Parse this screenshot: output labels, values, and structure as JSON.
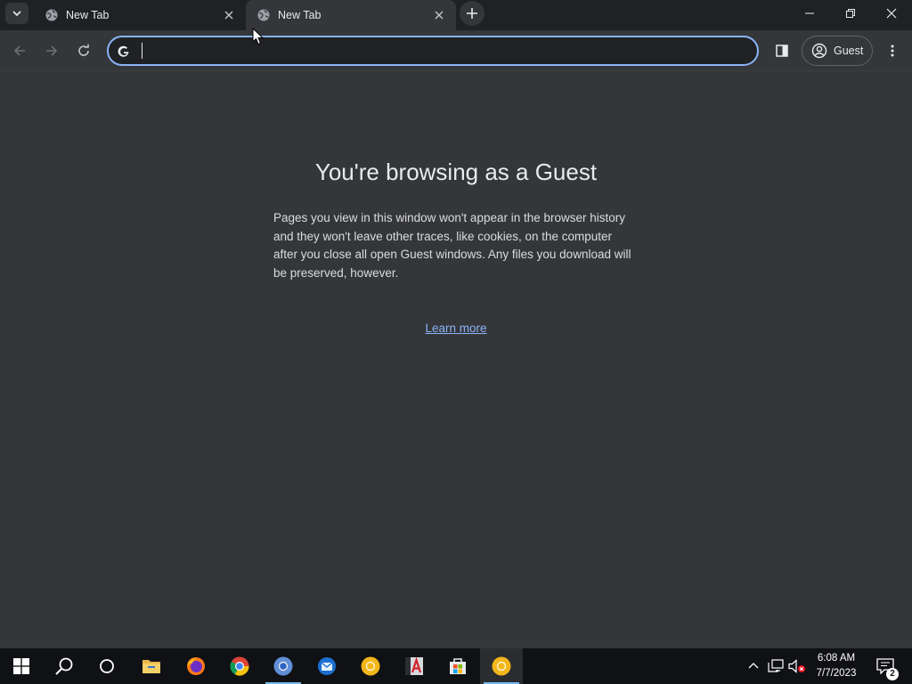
{
  "tabs": [
    {
      "title": "New Tab",
      "active": false
    },
    {
      "title": "New Tab",
      "active": true
    }
  ],
  "toolbar": {
    "omnibox_value": "",
    "profile_label": "Guest"
  },
  "content": {
    "heading": "You're browsing as a Guest",
    "description": "Pages you view in this window won't appear in the browser history and they won't leave other traces, like cookies, on the computer after you close all open Guest windows. Any files you download will be preserved, however.",
    "learn_more": "Learn more"
  },
  "taskbar": {
    "apps": [
      "start-icon",
      "search-icon",
      "cortana-icon",
      "file-explorer-icon",
      "firefox-icon",
      "chrome-icon",
      "chrome-icon",
      "thunderbird-icon",
      "chrome-canary-icon",
      "adobe-acrobat-icon",
      "microsoft-store-icon",
      "chrome-canary-icon"
    ],
    "time": "6:08 AM",
    "date": "7/7/2023",
    "notification_count": "2"
  },
  "colors": {
    "accent": "#8ab4f8",
    "page_bg": "#35363a",
    "frame_bg": "#202124",
    "taskbar_bg": "#101114"
  }
}
